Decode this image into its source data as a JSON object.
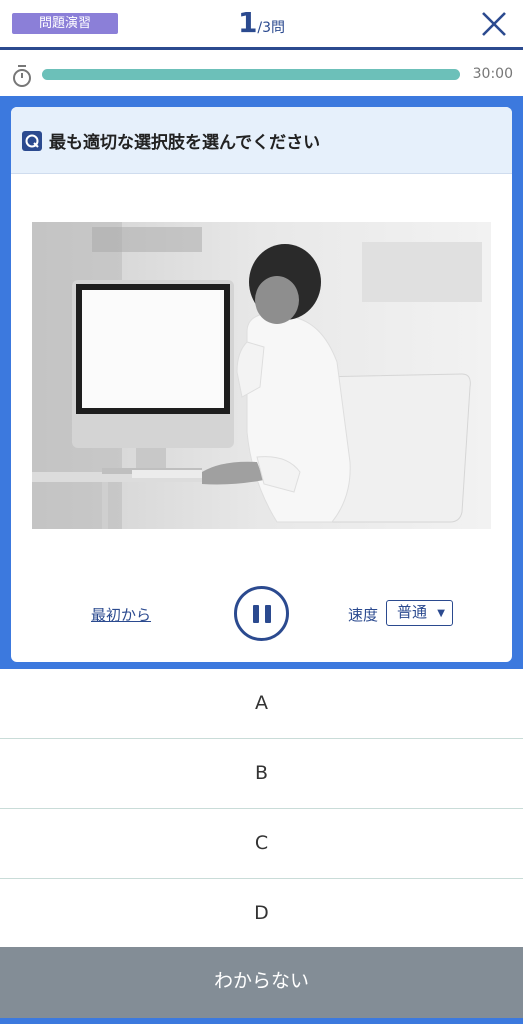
{
  "header": {
    "mode_badge": "問題演習",
    "current_question": "1",
    "total_suffix": "/3問"
  },
  "timer": {
    "progress": 1.0,
    "time_left": "30:00"
  },
  "question": {
    "instruction": "最も適切な選択肢を選んでください"
  },
  "player": {
    "restart_label": "最初から",
    "speed_label": "速度",
    "speed_value": "普通"
  },
  "answers": [
    {
      "label": "A"
    },
    {
      "label": "B"
    },
    {
      "label": "C"
    },
    {
      "label": "D"
    }
  ],
  "unknown_button": "わからない",
  "colors": {
    "brand_navy": "#2b4a8f",
    "frame_blue": "#3c79de",
    "badge_purple": "#8b7fd8",
    "progress_teal": "#6cc0b9",
    "unknown_gray": "#838d96"
  },
  "icons": {
    "close": "close-icon",
    "stopwatch": "stopwatch-icon",
    "question": "question-icon",
    "pause": "pause-icon",
    "dropdown": "caret-down-icon"
  }
}
